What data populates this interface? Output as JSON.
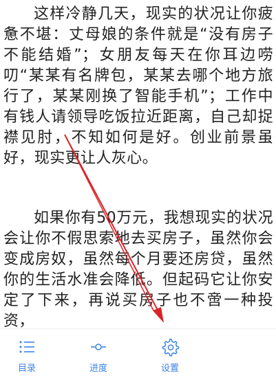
{
  "content": {
    "paragraphs": [
      "这样冷静几天，现实的状况让你疲惫不堪：丈母娘的条件就是“没有房子不能结婚”；女朋友每天在你耳边唠叨“某某有名牌包，某某去哪个地方旅行了，某某刚换了智能手机”；工作中有钱人请领导吃饭拉近距离，自己却捉襟见肘，不知如何是好。创业前景虽好，现实更让人灰心。",
      "如果你有50万元，我想现实的状况会让你不假思索地去买房子，虽然你会变成房奴，虽然每个月要还房贷，虽然你的生活水准会降低。但起码它让你安定了下来，再说买房子也不啻一种投资，"
    ]
  },
  "bottom_bar": {
    "tabs": [
      {
        "label": "目录",
        "icon": "list-icon"
      },
      {
        "label": "进度",
        "icon": "progress-icon"
      },
      {
        "label": "设置",
        "icon": "gear-icon"
      }
    ],
    "accent_color": "#3b82e6"
  },
  "annotation": {
    "arrow_color": "#d9252a",
    "arrow_icon": "red-arrow-icon"
  }
}
